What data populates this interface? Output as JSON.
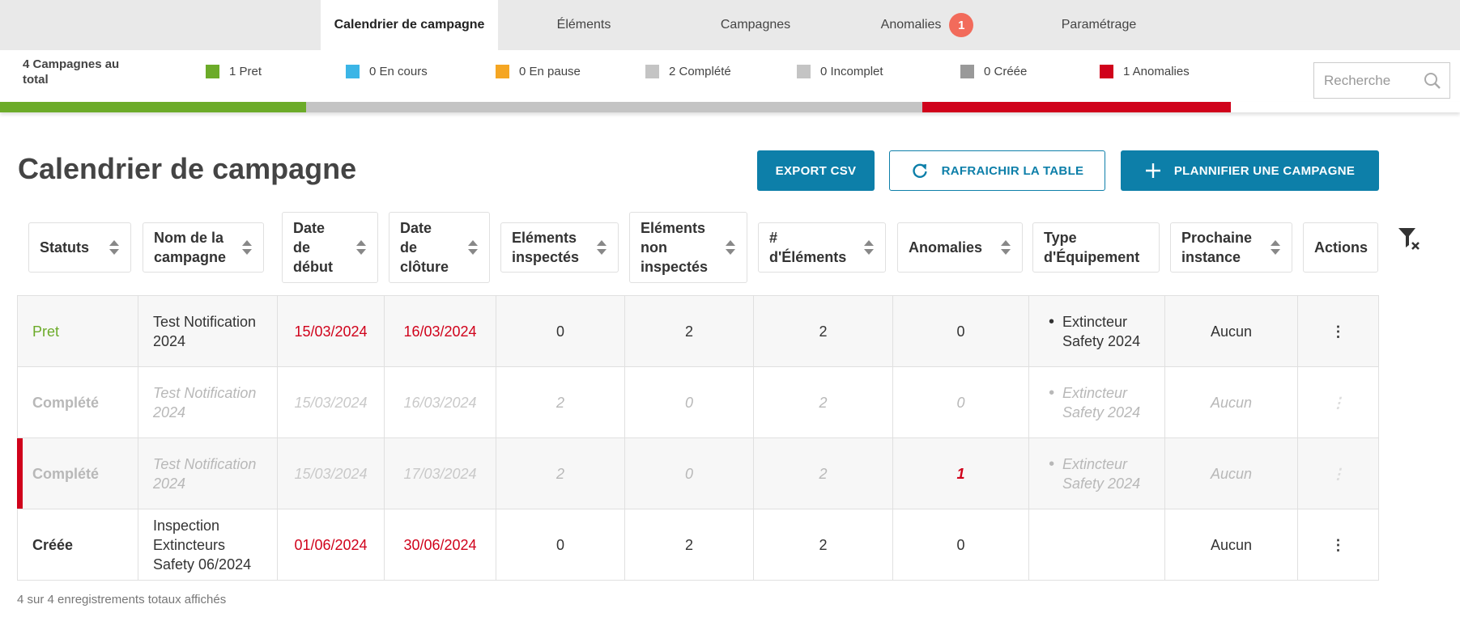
{
  "nav": {
    "tabs": [
      {
        "label": "Calendrier de campagne",
        "active": true
      },
      {
        "label": "Éléments"
      },
      {
        "label": "Campagnes"
      },
      {
        "label": "Anomalies",
        "badge": "1"
      },
      {
        "label": "Paramétrage"
      }
    ]
  },
  "stats": {
    "total": "4 Campagnes au total",
    "items": [
      {
        "label": "1 Pret",
        "color": "#6cab29"
      },
      {
        "label": "0 En cours",
        "color": "#3bb5e6"
      },
      {
        "label": "0 En pause",
        "color": "#f5a623"
      },
      {
        "label": "2 Complété",
        "color": "#c4c4c4"
      },
      {
        "label": "0 Incomplet",
        "color": "#c4c4c4"
      },
      {
        "label": "0 Créée",
        "color": "#999999"
      },
      {
        "label": "1 Anomalies",
        "color": "#d0021b"
      }
    ],
    "progress": [
      {
        "status": "Pret",
        "fraction": 0.25,
        "color": "#6cab29"
      },
      {
        "status": "Complété",
        "fraction": 0.5,
        "color": "#c4c4c4"
      },
      {
        "status": "Anomalies",
        "fraction": 0.25,
        "color": "#d0021b"
      }
    ]
  },
  "search": {
    "placeholder": "Recherche"
  },
  "page": {
    "title": "Calendrier de campagne",
    "export_label": "EXPORT CSV",
    "refresh_label": "RAFRAICHIR LA TABLE",
    "plan_label": "PLANNIFIER UNE CAMPAGNE"
  },
  "table": {
    "headers": [
      "Statuts",
      "Nom de la campagne",
      "Date de début",
      "Date de clôture",
      "Eléments inspectés",
      "Eléments non inspectés",
      "# d'Éléments",
      "Anomalies",
      "Type d'Équipement",
      "Prochaine instance",
      "Actions"
    ],
    "rows": [
      {
        "status": "Pret",
        "name": "Test Notification 2024",
        "start": "15/03/2024",
        "end": "16/03/2024",
        "inspected": "0",
        "not_inspected": "2",
        "count": "2",
        "anomalies": "0",
        "equipment": "Extincteur Safety 2024",
        "next": "Aucun",
        "action": "⋮"
      },
      {
        "status": "Complété",
        "name": "Test Notification 2024",
        "start": "15/03/2024",
        "end": "16/03/2024",
        "inspected": "2",
        "not_inspected": "0",
        "count": "2",
        "anomalies": "0",
        "equipment": "Extincteur Safety 2024",
        "next": "Aucun",
        "action": "⋮"
      },
      {
        "status": "Complété",
        "name": "Test Notification 2024",
        "start": "15/03/2024",
        "end": "17/03/2024",
        "inspected": "2",
        "not_inspected": "0",
        "count": "2",
        "anomalies": "1",
        "equipment": "Extincteur Safety 2024",
        "next": "Aucun",
        "action": "⋮"
      },
      {
        "status": "Créée",
        "name": "Inspection Extincteurs Safety 06/2024",
        "start": "01/06/2024",
        "end": "30/06/2024",
        "inspected": "0",
        "not_inspected": "2",
        "count": "2",
        "anomalies": "0",
        "equipment": "",
        "next": "Aucun",
        "action": "⋮"
      }
    ]
  },
  "footer": {
    "text": "4  sur  4  enregistrements totaux affichés"
  }
}
